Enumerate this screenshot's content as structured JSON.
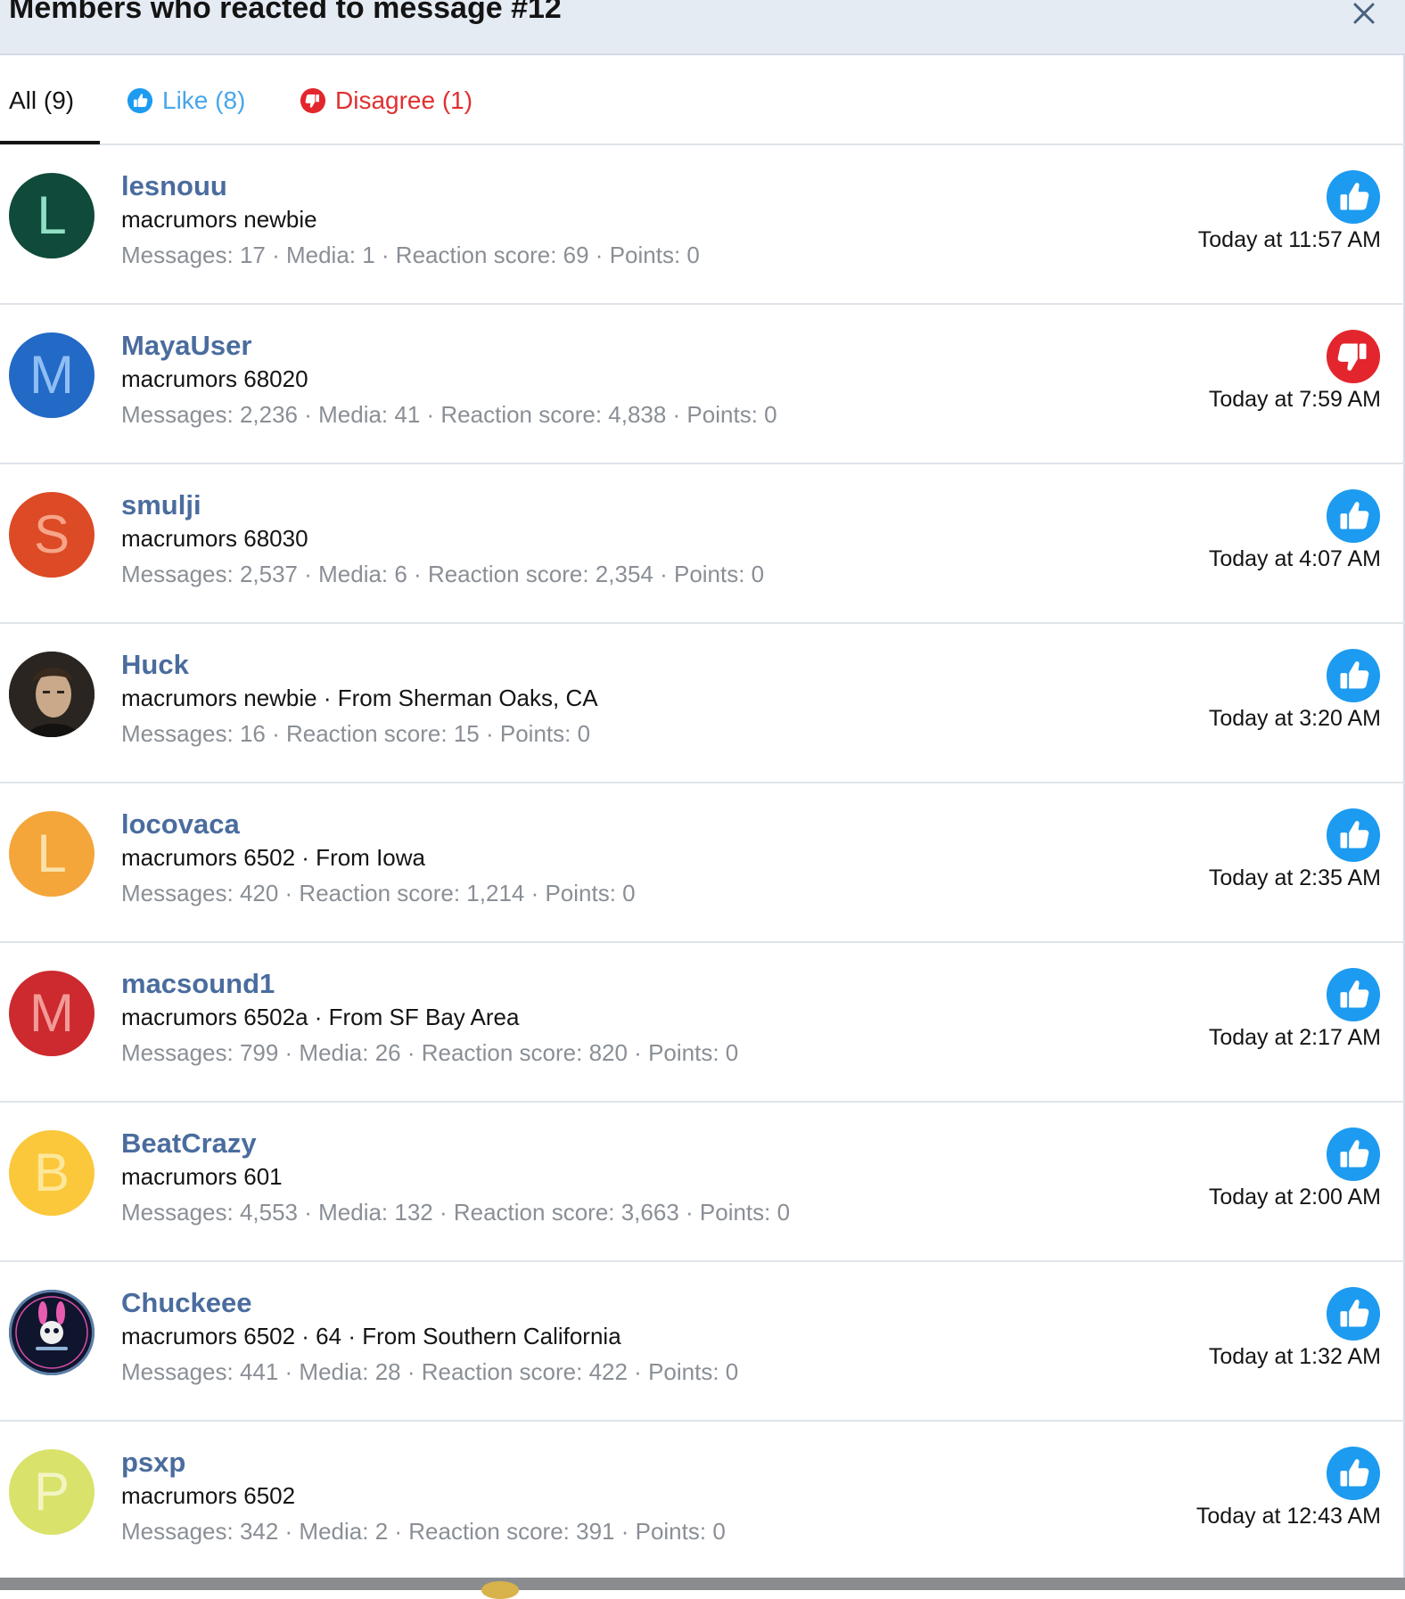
{
  "dialog": {
    "title": "Members who reacted to message #12",
    "close_icon": "close-icon"
  },
  "tabs": [
    {
      "label": "All (9)",
      "icon": null
    },
    {
      "label": "Like (8)",
      "icon": "like-icon"
    },
    {
      "label": "Disagree (1)",
      "icon": "disagree-icon"
    }
  ],
  "colors": {
    "like": "#1d9bf0",
    "disagree": "#e3262d",
    "username": "#4a6c9e"
  },
  "members": [
    {
      "username": "lesnouu",
      "avatar_letter": "L",
      "avatar_bg": "#0f4a3a",
      "avatar_fg": "#8fe0c4",
      "title": "macrumors newbie",
      "stats": "Messages: 17 · Media: 1 · Reaction score: 69 · Points: 0",
      "reaction": "like",
      "time": "Today at 11:57 AM"
    },
    {
      "username": "MayaUser",
      "avatar_letter": "M",
      "avatar_bg": "#2369c6",
      "avatar_fg": "#8fbef5",
      "title": "macrumors 68020",
      "stats": "Messages: 2,236 · Media: 41 · Reaction score: 4,838 · Points: 0",
      "reaction": "disagree",
      "time": "Today at 7:59 AM"
    },
    {
      "username": "smulji",
      "avatar_letter": "S",
      "avatar_bg": "#dc4a26",
      "avatar_fg": "#f7a488",
      "title": "macrumors 68030",
      "stats": "Messages: 2,537 · Media: 6 · Reaction score: 2,354 · Points: 0",
      "reaction": "like",
      "time": "Today at 4:07 AM"
    },
    {
      "username": "Huck",
      "avatar_letter": "",
      "avatar_bg": "#2a2520",
      "avatar_fg": "#d8c3a8",
      "avatar_photo": "photo",
      "title": "macrumors newbie · From Sherman Oaks, CA",
      "stats": "Messages: 16 · Reaction score: 15 · Points: 0",
      "reaction": "like",
      "time": "Today at 3:20 AM"
    },
    {
      "username": "locovaca",
      "avatar_letter": "L",
      "avatar_bg": "#f4a63a",
      "avatar_fg": "#fbe1a8",
      "title": "macrumors 6502 · From Iowa",
      "stats": "Messages: 420 · Reaction score: 1,214 · Points: 0",
      "reaction": "like",
      "time": "Today at 2:35 AM"
    },
    {
      "username": "macsound1",
      "avatar_letter": "M",
      "avatar_bg": "#cc2a2e",
      "avatar_fg": "#f29a98",
      "title": "macrumors 6502a · From SF Bay Area",
      "stats": "Messages: 799 · Media: 26 · Reaction score: 820 · Points: 0",
      "reaction": "like",
      "time": "Today at 2:17 AM"
    },
    {
      "username": "BeatCrazy",
      "avatar_letter": "B",
      "avatar_bg": "#fbc83c",
      "avatar_fg": "#fde79a",
      "title": "macrumors 601",
      "stats": "Messages: 4,553 · Media: 132 · Reaction score: 3,663 · Points: 0",
      "reaction": "like",
      "time": "Today at 2:00 AM"
    },
    {
      "username": "Chuckeee",
      "avatar_letter": "",
      "avatar_bg": "#10152e",
      "avatar_fg": "#e85cb0",
      "avatar_photo": "bunny",
      "title": "macrumors 6502 · 64 · From Southern California",
      "stats": "Messages: 441 · Media: 28 · Reaction score: 422 · Points: 0",
      "reaction": "like",
      "time": "Today at 1:32 AM"
    },
    {
      "username": "psxp",
      "avatar_letter": "P",
      "avatar_bg": "#d9e26a",
      "avatar_fg": "#f2f5c2",
      "title": "macrumors 6502",
      "stats": "Messages: 342 · Media: 2 · Reaction score: 391 · Points: 0",
      "reaction": "like",
      "time": "Today at 12:43 AM"
    }
  ]
}
